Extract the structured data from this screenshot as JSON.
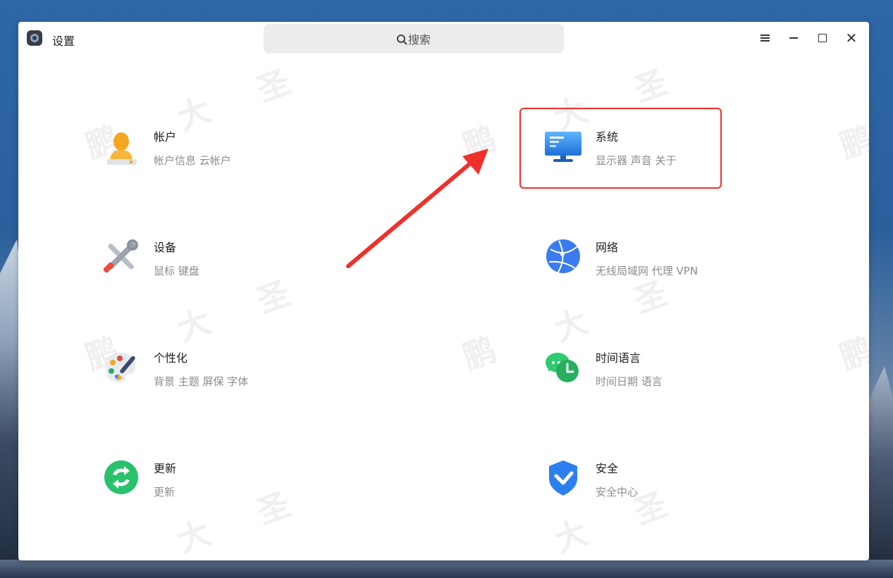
{
  "window": {
    "title": "设置",
    "search_placeholder": "搜索"
  },
  "watermark": [
    "鹏",
    "大",
    "圣"
  ],
  "categories": [
    {
      "title": "帐户",
      "desc": "帐户信息 云帐户",
      "icon": "account-icon"
    },
    {
      "title": "系统",
      "desc": "显示器 声音 关于",
      "icon": "monitor-icon"
    },
    {
      "title": "设备",
      "desc": "鼠标 键盘",
      "icon": "tools-icon"
    },
    {
      "title": "网络",
      "desc": "无线局域网 代理 VPN",
      "icon": "globe-icon"
    },
    {
      "title": "个性化",
      "desc": "背景 主题 屏保 字体",
      "icon": "palette-icon"
    },
    {
      "title": "时间语言",
      "desc": "时间日期 语言",
      "icon": "time-language-icon"
    },
    {
      "title": "更新",
      "desc": "更新",
      "icon": "update-icon"
    },
    {
      "title": "安全",
      "desc": "安全中心",
      "icon": "shield-icon"
    }
  ],
  "annotation": {
    "highlight_color": "#f0302a"
  }
}
